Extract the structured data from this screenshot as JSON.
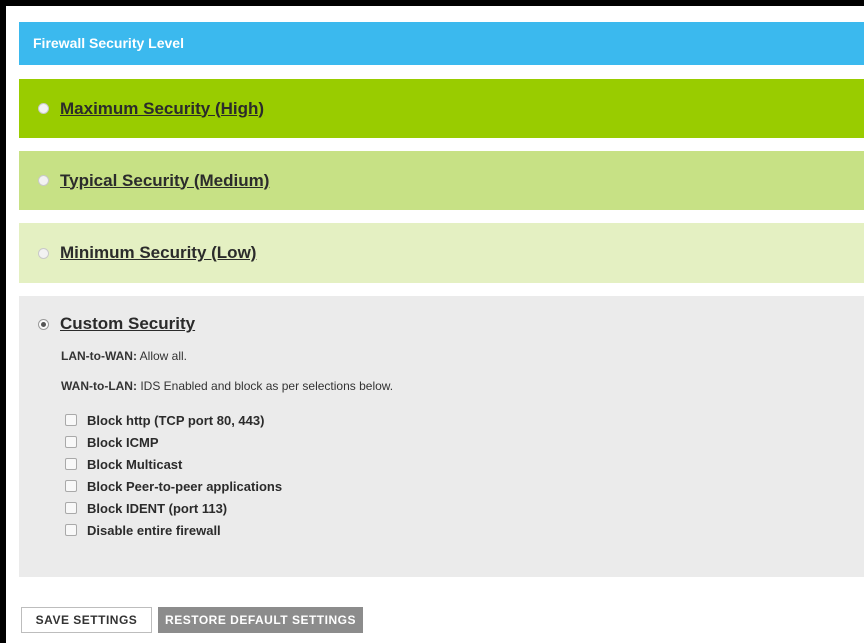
{
  "header": {
    "title": "Firewall Security Level"
  },
  "options": [
    {
      "label": "Maximum Security (High)",
      "checked": false,
      "color": "#99cc00"
    },
    {
      "label": "Typical Security (Medium)",
      "checked": false,
      "color": "#c7e185"
    },
    {
      "label": "Minimum Security (Low)",
      "checked": false,
      "color": "#e4f0c2"
    }
  ],
  "custom": {
    "label": "Custom Security",
    "checked": true,
    "lan_to_wan": {
      "key": "LAN-to-WAN:",
      "value": " Allow all."
    },
    "wan_to_lan": {
      "key": "WAN-to-LAN:",
      "value": " IDS Enabled and block as per selections below."
    },
    "checkboxes": [
      {
        "label": "Block http (TCP port 80, 443)",
        "checked": false
      },
      {
        "label": "Block ICMP",
        "checked": false
      },
      {
        "label": "Block Multicast",
        "checked": false
      },
      {
        "label": "Block Peer-to-peer applications",
        "checked": false
      },
      {
        "label": "Block IDENT (port 113)",
        "checked": false
      },
      {
        "label": "Disable entire firewall",
        "checked": false
      }
    ]
  },
  "buttons": {
    "save_label": "SAVE SETTINGS",
    "restore_label": "RESTORE DEFAULT SETTINGS"
  },
  "colors": {
    "header": "#3bb9ee",
    "custom_panel": "#ebebeb",
    "restore_button": "#8c8c8c"
  }
}
